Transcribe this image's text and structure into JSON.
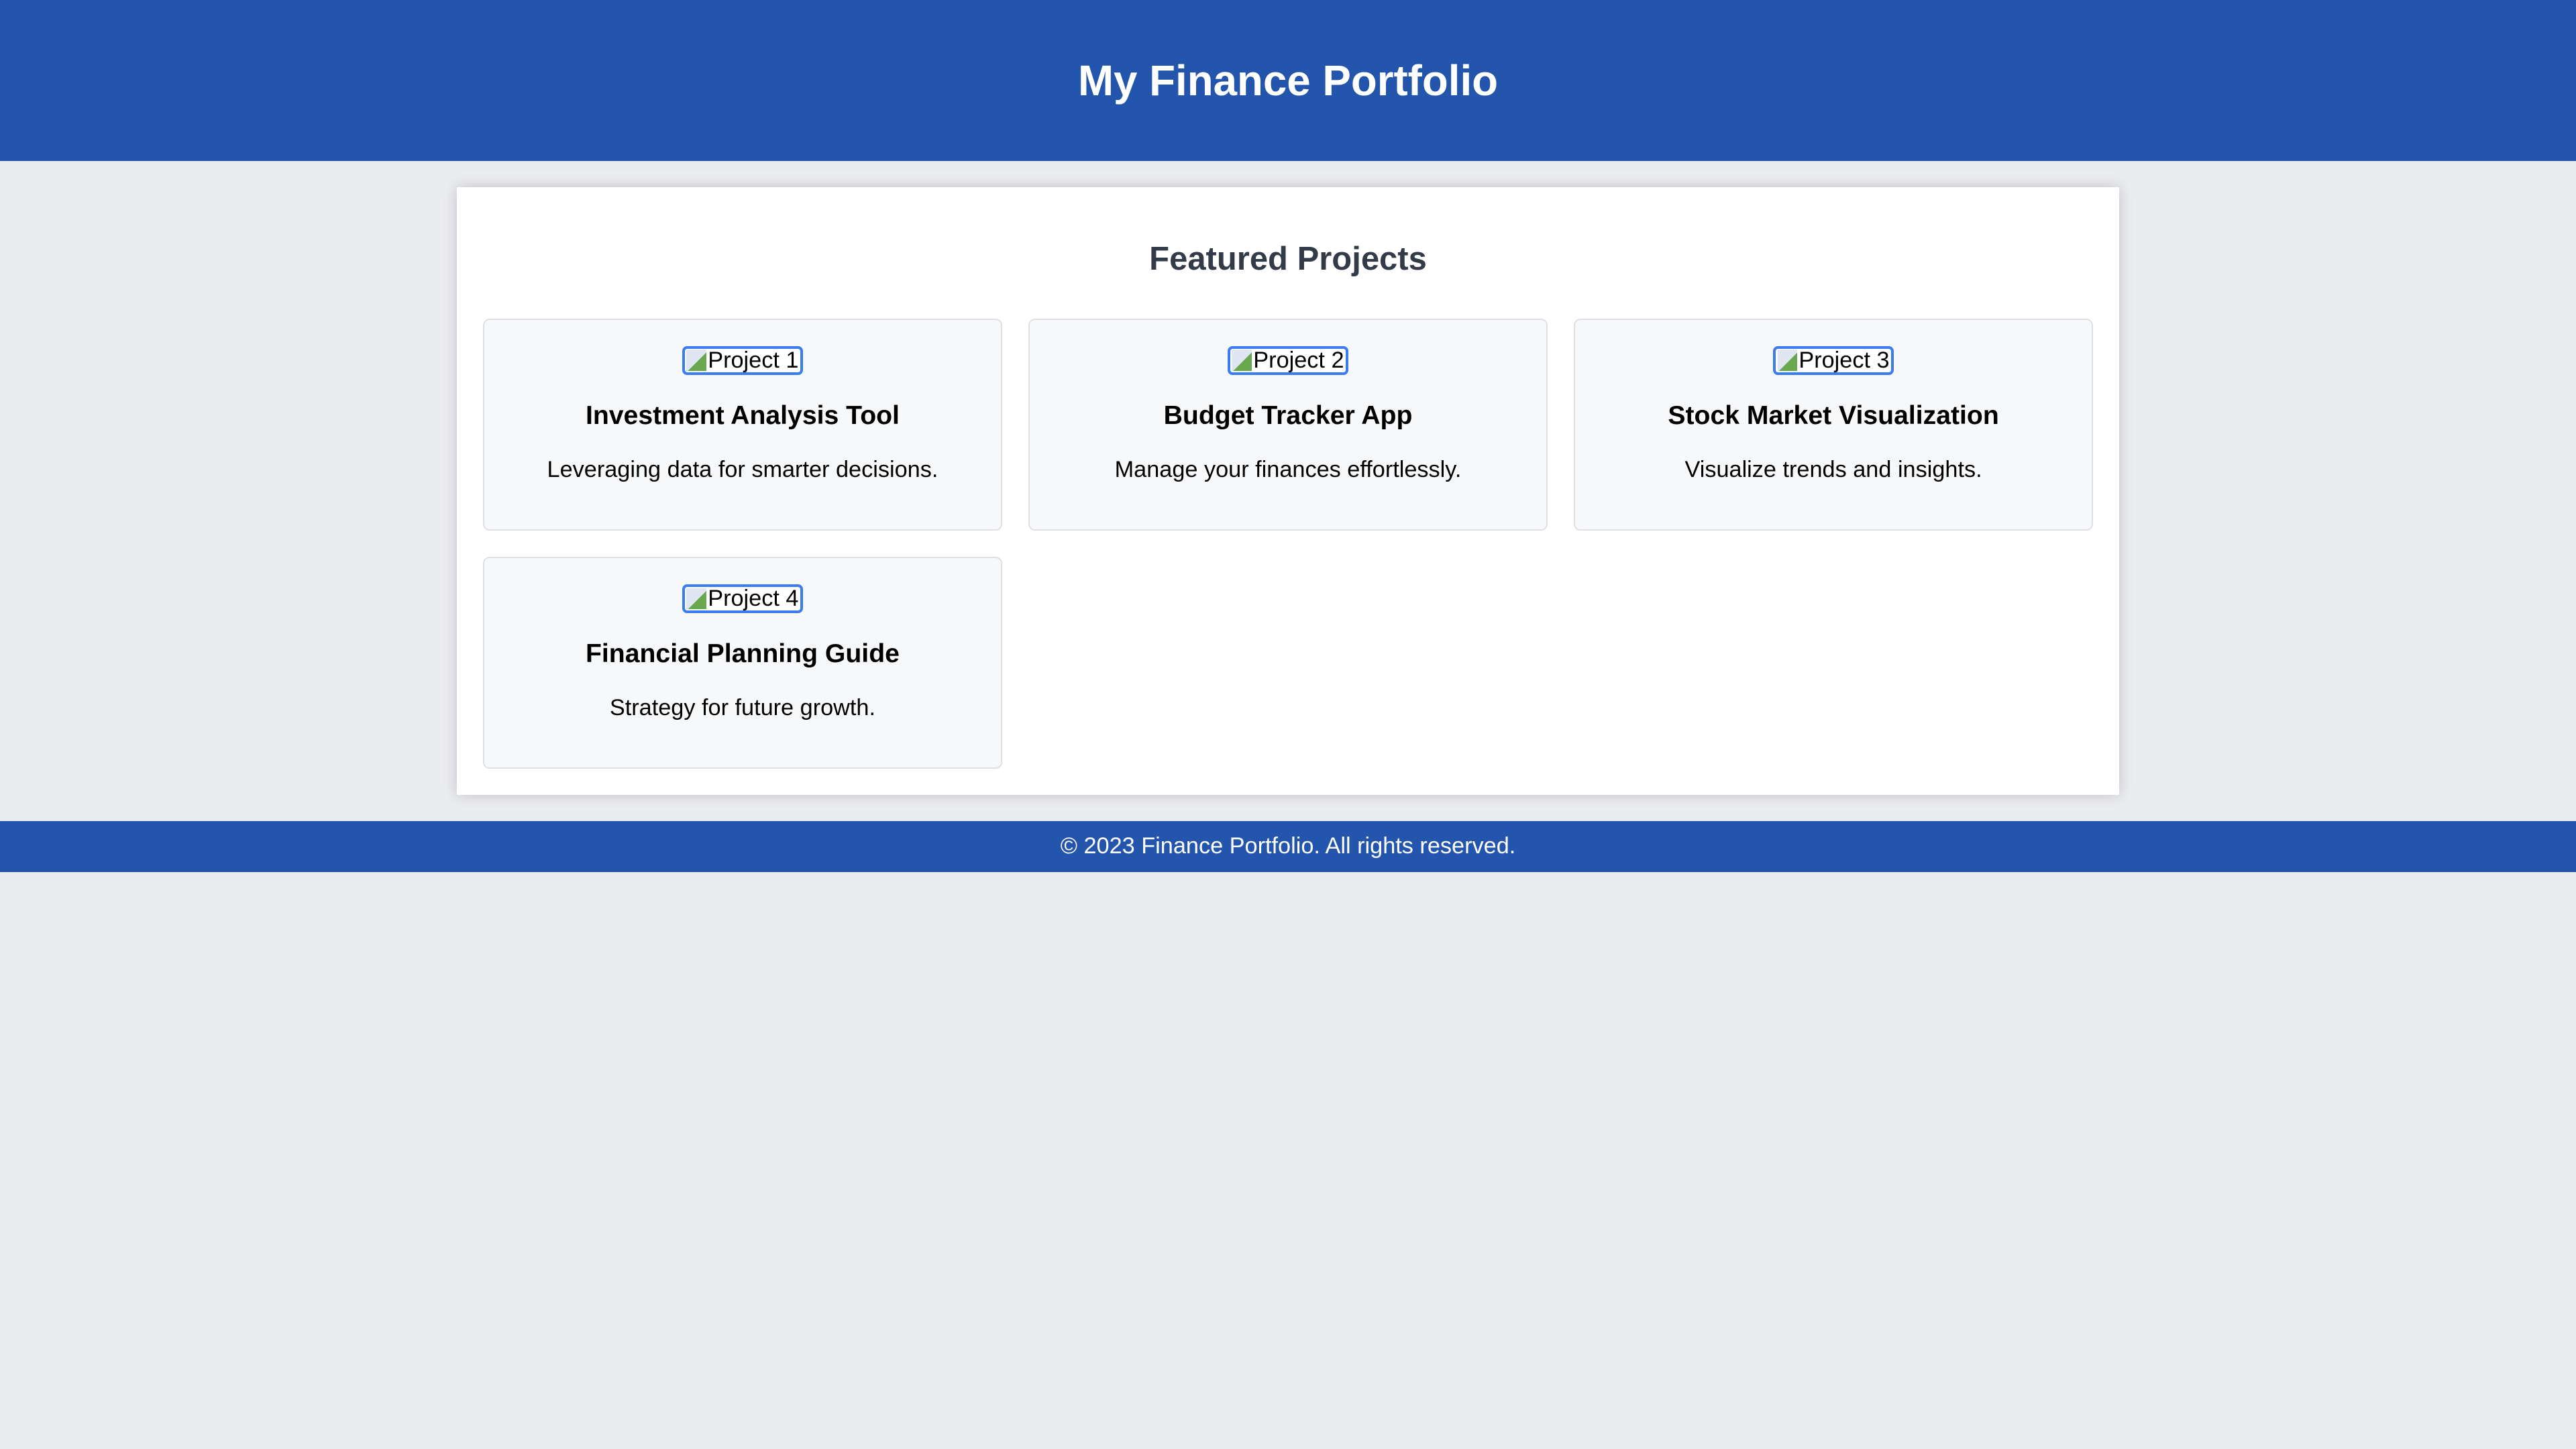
{
  "header": {
    "title": "My Finance Portfolio"
  },
  "section": {
    "title": "Featured Projects"
  },
  "projects": [
    {
      "image_alt": "Project 1",
      "title": "Investment Analysis Tool",
      "description": "Leveraging data for smarter decisions."
    },
    {
      "image_alt": "Project 2",
      "title": "Budget Tracker App",
      "description": "Manage your finances effortlessly."
    },
    {
      "image_alt": "Project 3",
      "title": "Stock Market Visualization",
      "description": "Visualize trends and insights."
    },
    {
      "image_alt": "Project 4",
      "title": "Financial Planning Guide",
      "description": "Strategy for future growth."
    }
  ],
  "footer": {
    "text": "© 2023 Finance Portfolio. All rights reserved."
  }
}
